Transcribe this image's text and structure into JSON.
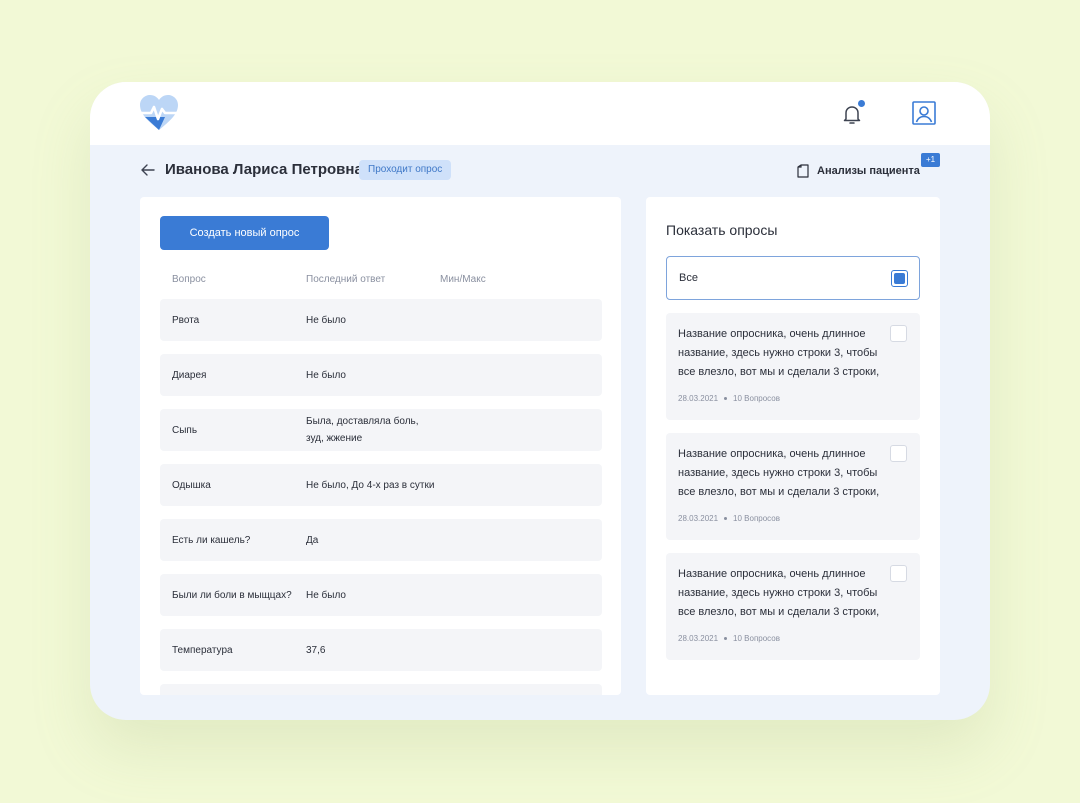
{
  "header": {
    "patient_name": "Иванова Лариса Петровна",
    "status": "Проходит опрос",
    "analyses_label": "Анализы пациента",
    "analyses_badge": "+1"
  },
  "survey_table": {
    "create_button": "Создать новый опрос",
    "columns": [
      "Вопрос",
      "Последний ответ",
      "Мин/Макс"
    ],
    "rows": [
      {
        "question": "Рвота",
        "answer": "Не было"
      },
      {
        "question": "Диарея",
        "answer": "Не было"
      },
      {
        "question": "Сыпь",
        "answer": "Была, доставляла боль, зуд, жжение"
      },
      {
        "question": "Одышка",
        "answer": "Не было, До 4-х раз в сутки"
      },
      {
        "question": "Есть ли кашель?",
        "answer": "Да"
      },
      {
        "question": "Были ли боли в мыщцах?",
        "answer": "Не было"
      },
      {
        "question": "Температура",
        "answer": "37,6"
      }
    ]
  },
  "filter": {
    "title": "Показать опросы",
    "all_label": "Все",
    "surveys": [
      {
        "name": "Название опросника, очень длинное название, здесь нужно строки 3, чтобы все влезло, вот мы и сделали 3 строки,",
        "date": "28.03.2021",
        "count": "10 Вопросов"
      },
      {
        "name": "Название опросника, очень длинное название, здесь нужно строки 3, чтобы все влезло, вот мы и сделали 3 строки,",
        "date": "28.03.2021",
        "count": "10 Вопросов"
      },
      {
        "name": "Название опросника, очень длинное название, здесь нужно строки 3, чтобы все влезло, вот мы и сделали 3 строки,",
        "date": "28.03.2021",
        "count": "10 Вопросов"
      }
    ]
  },
  "colors": {
    "accent": "#3a7bd5",
    "page_background": "#f2f9d6",
    "app_background": "#eef3fb",
    "badge_background": "#cfe1fa"
  },
  "icons": [
    "heart-pulse-logo-icon",
    "bell-icon",
    "profile-icon",
    "back-arrow-icon",
    "document-icon"
  ]
}
